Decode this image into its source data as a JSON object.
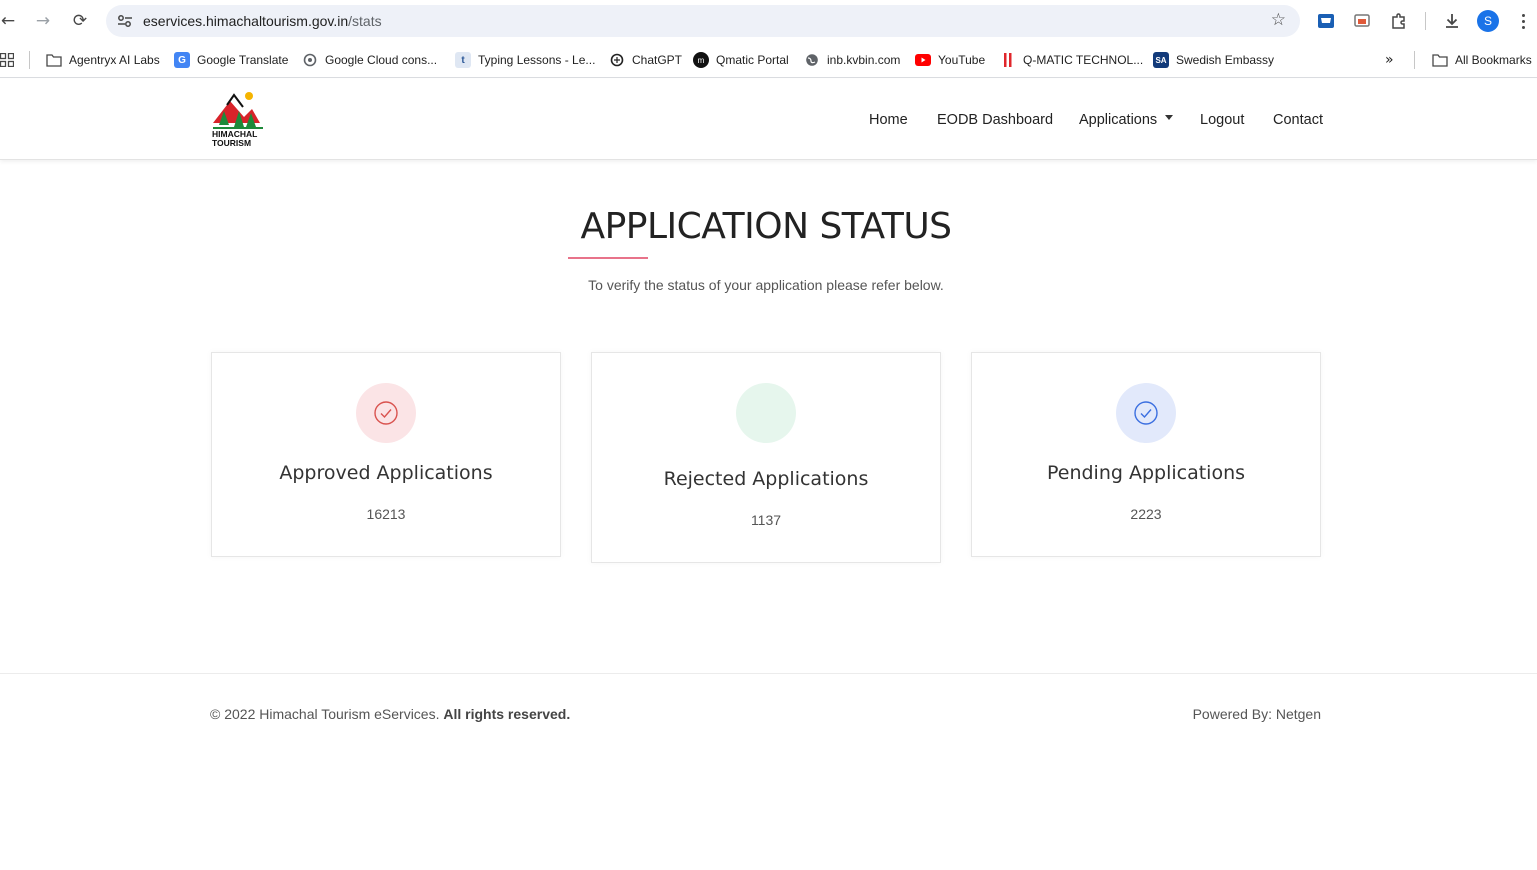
{
  "browser": {
    "url_host": "eservices.himachaltourism.gov.in",
    "url_path": "/stats",
    "avatar_letter": "S",
    "bookmarks": [
      {
        "label": "Agentryx AI Labs",
        "icon": "folder-icon"
      },
      {
        "label": "Google Translate",
        "icon": "google-translate-icon"
      },
      {
        "label": "Google Cloud cons...",
        "icon": "google-cloud-icon"
      },
      {
        "label": "Typing Lessons - Le...",
        "icon": "typing-icon"
      },
      {
        "label": "ChatGPT",
        "icon": "chatgpt-icon"
      },
      {
        "label": "Qmatic Portal",
        "icon": "qmatic-icon"
      },
      {
        "label": "inb.kvbin.com",
        "icon": "globe-icon"
      },
      {
        "label": "YouTube",
        "icon": "youtube-icon"
      },
      {
        "label": "Q-MATIC TECHNOL...",
        "icon": "qmatic-tech-icon"
      },
      {
        "label": "Swedish Embassy",
        "icon": "sa-icon"
      }
    ],
    "all_bookmarks_label": "All Bookmarks"
  },
  "site": {
    "logo_text_1": "HIMACHAL",
    "logo_text_2": "TOURISM",
    "nav": {
      "home": "Home",
      "eodb": "EODB Dashboard",
      "applications": "Applications",
      "logout": "Logout",
      "contact": "Contact"
    }
  },
  "main": {
    "title": "APPLICATION STATUS",
    "subtitle": "To verify the status of your application please refer below.",
    "cards": [
      {
        "title": "Approved Applications",
        "value": "16213",
        "icon": "check-circle-icon",
        "circle_color": "#fbe4e6",
        "icon_color": "#d9534f"
      },
      {
        "title": "Rejected Applications",
        "value": "1137",
        "icon": "",
        "circle_color": "#e6f6ed",
        "icon_color": "#28a745"
      },
      {
        "title": "Pending Applications",
        "value": "2223",
        "icon": "check-circle-icon",
        "circle_color": "#e2e9fb",
        "icon_color": "#3b6fe0"
      }
    ]
  },
  "footer": {
    "copyright": "© 2022 Himachal Tourism eServices.",
    "rights": "All rights reserved.",
    "powered": "Powered By: Netgen"
  }
}
